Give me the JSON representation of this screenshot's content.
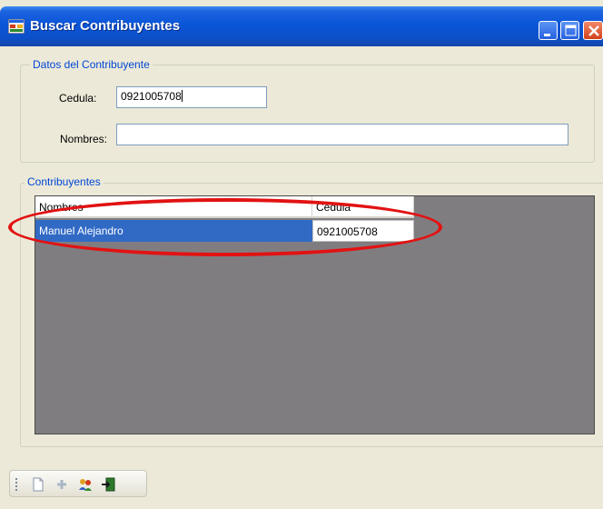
{
  "window": {
    "title": "Buscar Contribuyentes"
  },
  "datos_group": {
    "title": "Datos del Contribuyente",
    "cedula_label": "Cedula:",
    "cedula_value": "0921005708",
    "nombres_label": "Nombres:",
    "nombres_value": ""
  },
  "contribuyentes_group": {
    "title": "Contribuyentes",
    "columns": [
      "Nombres",
      "Cedula"
    ],
    "rows": [
      {
        "nombres": "Manuel Alejandro",
        "cedula": "0921005708",
        "selected": true
      }
    ]
  },
  "toolbar": {
    "items": [
      "new-document-icon",
      "add-icon",
      "search-people-icon",
      "exit-icon"
    ]
  },
  "colors": {
    "titlebar": "#0A55D8",
    "selection": "#316AC5",
    "group_title": "#0046D5",
    "annotation": "#E21212",
    "grid_background": "#807D81"
  }
}
